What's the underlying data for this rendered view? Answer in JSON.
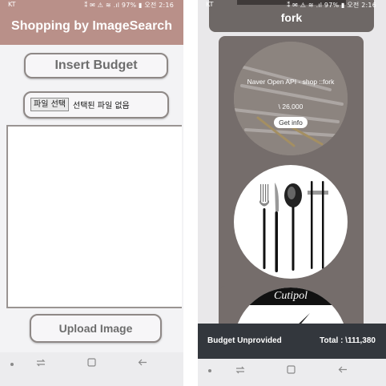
{
  "left": {
    "statusbar": {
      "carrier": "KT",
      "right": "⁑ ✉ ⚠ ≋ .ıl 97% ▮ 오전 2:16"
    },
    "header": {
      "title": "Shopping by ImageSearch"
    },
    "insert_budget_label": "Insert Budget",
    "file_input": {
      "button_label": "파일 선택",
      "status": "선택된 파일 없음"
    },
    "upload_label": "Upload Image"
  },
  "right": {
    "statusbar": {
      "carrier": "KT",
      "right": "⁑ ✉ ⚠ ≋ .ıl 97% ▮ 오전 2:16"
    },
    "top_card_label": "fork",
    "product": {
      "title": "Naver Open API - shop ::fork",
      "price": "\\ 26,000",
      "info_label": "Get info"
    },
    "brand_logo": "Cutipol",
    "budget_bar": {
      "status": "Budget Unprovided",
      "total": "Total : \\111,380"
    }
  },
  "icons": {
    "nav_recent": "recent-apps-icon",
    "nav_home": "home-icon",
    "nav_back": "back-icon"
  },
  "colors": {
    "header": "#b99089",
    "card": "#756d6b",
    "budget_bar": "#33373d"
  }
}
